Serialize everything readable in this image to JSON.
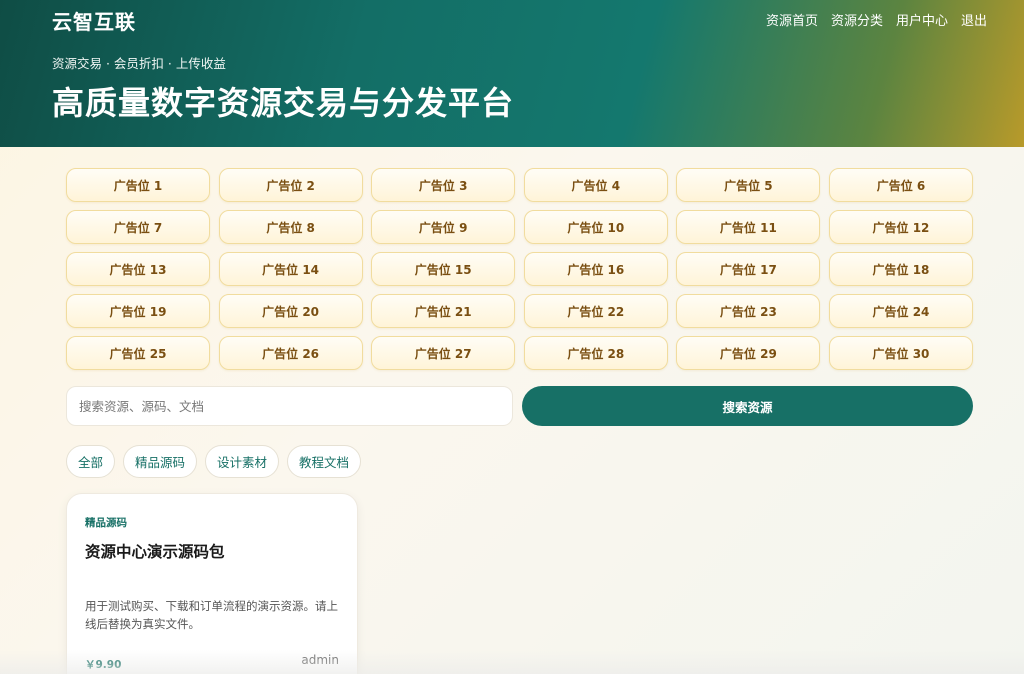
{
  "header": {
    "logo": "云智互联",
    "nav": [
      {
        "label": "资源首页"
      },
      {
        "label": "资源分类"
      },
      {
        "label": "用户中心"
      },
      {
        "label": "退出"
      }
    ],
    "tagline": "资源交易 · 会员折扣 · 上传收益",
    "title": "高质量数字资源交易与分发平台"
  },
  "ads": [
    "广告位 1",
    "广告位 2",
    "广告位 3",
    "广告位 4",
    "广告位 5",
    "广告位 6",
    "广告位 7",
    "广告位 8",
    "广告位 9",
    "广告位 10",
    "广告位 11",
    "广告位 12",
    "广告位 13",
    "广告位 14",
    "广告位 15",
    "广告位 16",
    "广告位 17",
    "广告位 18",
    "广告位 19",
    "广告位 20",
    "广告位 21",
    "广告位 22",
    "广告位 23",
    "广告位 24",
    "广告位 25",
    "广告位 26",
    "广告位 27",
    "广告位 28",
    "广告位 29",
    "广告位 30"
  ],
  "search": {
    "placeholder": "搜索资源、源码、文档",
    "value": "",
    "button_label": "搜索资源"
  },
  "filters": [
    "全部",
    "精品源码",
    "设计素材",
    "教程文档"
  ],
  "resources": [
    {
      "category": "精品源码",
      "title": "资源中心演示源码包",
      "description": "用于测试购买、下载和订单流程的演示资源。请上线后替换为真实文件。",
      "price": "￥9.90",
      "author": "admin"
    }
  ],
  "colors": {
    "accent": "#177066",
    "ad_text": "#7a4f12",
    "ad_border": "#f1dc9e"
  }
}
